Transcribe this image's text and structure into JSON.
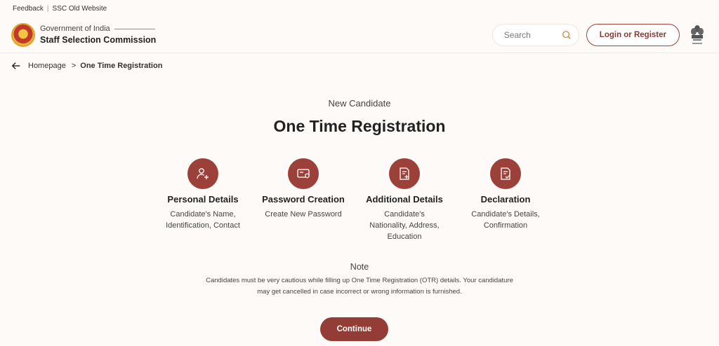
{
  "topbar": {
    "feedback": "Feedback",
    "separator": "|",
    "old_website": "SSC Old Website"
  },
  "header": {
    "gov_label": "Government of India",
    "org_name": "Staff Selection Commission",
    "search_placeholder": "Search",
    "login_label": "Login or Register"
  },
  "breadcrumb": {
    "home": "Homepage",
    "separator": ">",
    "current": "One Time Registration"
  },
  "main": {
    "subtitle": "New Candidate",
    "title": "One Time Registration"
  },
  "steps": [
    {
      "icon": "add-user-icon",
      "title": "Personal Details",
      "desc_lines": [
        "Candidate's Name,",
        "Identification, Contact"
      ]
    },
    {
      "icon": "password-card-icon",
      "title": "Password Creation",
      "desc_lines": [
        "Create New Password"
      ]
    },
    {
      "icon": "document-add-icon",
      "title": "Additional Details",
      "desc_lines": [
        "Candidate's",
        "Nationality, Address,",
        "Education"
      ]
    },
    {
      "icon": "document-check-icon",
      "title": "Declaration",
      "desc_lines": [
        "Candidate's Details,",
        "Confirmation"
      ]
    }
  ],
  "note": {
    "title": "Note",
    "line1": "Candidates must be very cautious while filling up One Time Registration (OTR) details. Your candidature",
    "line2": "may get cancelled in case incorrect or wrong information is furnished."
  },
  "continue_label": "Continue",
  "colors": {
    "accent": "#933d36",
    "background": "#fdfaf7"
  }
}
